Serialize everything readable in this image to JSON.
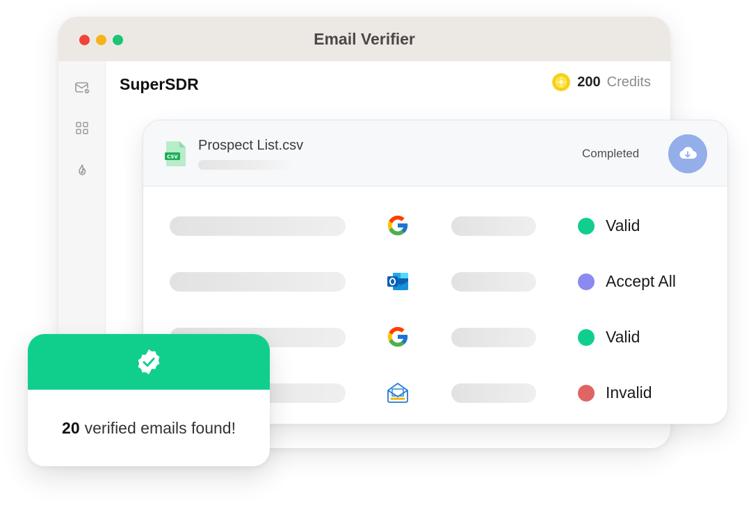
{
  "window": {
    "title": "Email Verifier",
    "brand": "SuperSDR",
    "credits": {
      "amount": "200",
      "label": "Credits",
      "icon": "coin-icon"
    },
    "sidebar": [
      {
        "icon": "mail-check-icon"
      },
      {
        "icon": "grid-icon"
      },
      {
        "icon": "fire-icon"
      }
    ]
  },
  "panel": {
    "file_name": "Prospect List.csv",
    "file_type": "CSV",
    "status": "Completed",
    "download_icon": "cloud-download-icon",
    "rows": [
      {
        "provider": "google-icon",
        "status": "Valid",
        "status_color": "#10cf8c"
      },
      {
        "provider": "outlook-icon",
        "status": "Accept All",
        "status_color": "#8a8af0"
      },
      {
        "provider": "google-icon",
        "status": "Valid",
        "status_color": "#10cf8c"
      },
      {
        "provider": "mail-app-icon",
        "status": "Invalid",
        "status_color": "#e06464"
      }
    ]
  },
  "toast": {
    "count": "20",
    "message": "verified emails found!",
    "icon": "verified-badge-icon"
  },
  "colors": {
    "accent_green": "#10cf8c",
    "download_button": "#93aee9",
    "titlebar": "#ece9e5"
  }
}
